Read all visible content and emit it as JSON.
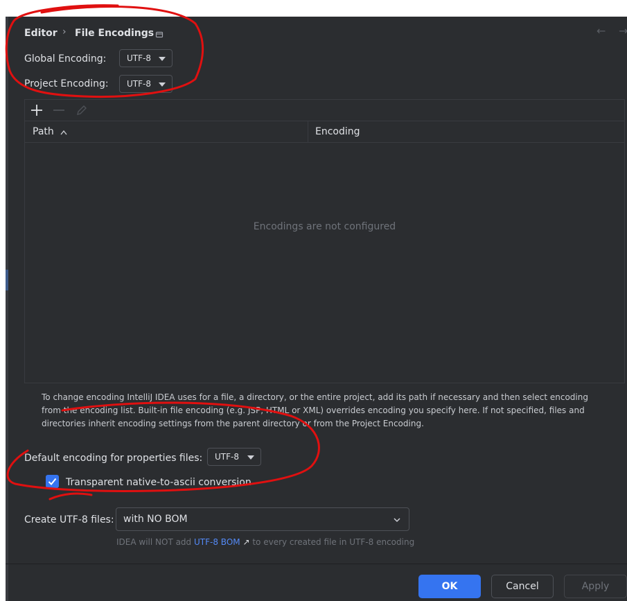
{
  "breadcrumb": {
    "parent": "Editor",
    "current": "File Encodings"
  },
  "global_encoding": {
    "label": "Global Encoding:",
    "value": "UTF-8"
  },
  "project_encoding": {
    "label": "Project Encoding:",
    "value": "UTF-8"
  },
  "table": {
    "columns": [
      {
        "label": "Path"
      },
      {
        "label": "Encoding"
      }
    ],
    "empty_text": "Encodings are not configured"
  },
  "help_lines": [
    "To change encoding IntelliJ IDEA uses for a file, a directory, or the entire project, add its path if necessary and then select encoding",
    "from the encoding list. Built-in file encoding (e.g. JSP, HTML or XML) overrides encoding you specify here. If not specified, files and",
    "directories inherit encoding settings from the parent directory or from the Project Encoding."
  ],
  "properties_encoding": {
    "label": "Default encoding for properties files:",
    "value": "UTF-8"
  },
  "native_to_ascii": {
    "label": "Transparent native-to-ascii conversion",
    "checked": true
  },
  "create_utf8": {
    "label": "Create UTF-8 files:",
    "value": "with NO BOM",
    "hint_prefix": "IDEA will NOT add",
    "hint_link": "UTF-8 BOM",
    "hint_suffix": "to every created file in UTF-8 encoding"
  },
  "buttons": {
    "ok": "OK",
    "cancel": "Cancel",
    "apply": "Apply"
  },
  "colors": {
    "accent": "#3574f0",
    "link": "#548af7",
    "annotation": "#e01010"
  }
}
